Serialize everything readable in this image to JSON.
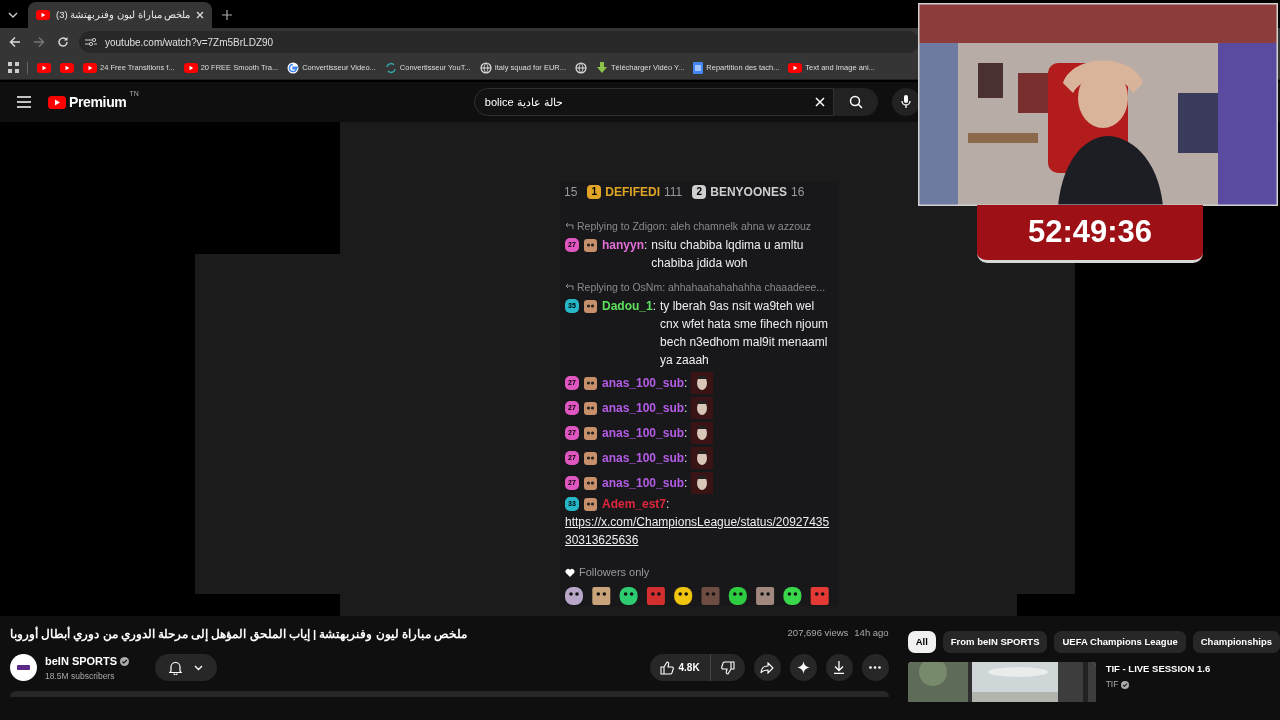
{
  "browser": {
    "tab": {
      "title": "(3) ملخص مباراة ليون وفنربهتشة",
      "selected": true
    },
    "address": "youtube.com/watch?v=7Zm5BrLDZ90",
    "bookmarks": [
      {
        "kind": "youtube"
      },
      {
        "kind": "youtube"
      },
      {
        "kind": "youtube",
        "label": "24 Free Transitions f..."
      },
      {
        "kind": "youtube",
        "label": "20 FREE Smooth Tra..."
      },
      {
        "kind": "google",
        "label": "Convertisseur Video..."
      },
      {
        "kind": "sync",
        "label": "Convertisseur YouT..."
      },
      {
        "kind": "globe",
        "label": "Italy squad for EUR..."
      },
      {
        "kind": "globe"
      },
      {
        "kind": "download",
        "label": "Télécharger Vidéo Y..."
      },
      {
        "kind": "doc",
        "label": "Repartition des tach..."
      },
      {
        "kind": "youtube",
        "label": "Text and Image ani..."
      }
    ]
  },
  "youtube": {
    "logo": "Premium",
    "region": "TN",
    "search": "bolice حالة عادية"
  },
  "stream": {
    "leaderboard": [
      {
        "score": "15"
      },
      {
        "rank": "1",
        "name": "DEFIFEDI",
        "score": "111",
        "color": "#e0a526"
      },
      {
        "rank": "2",
        "name": "BENYOONES",
        "score": "16",
        "color": "#cfcfcf"
      }
    ],
    "messages": [
      {
        "kind": "reply",
        "text": "Replying to Zdigon: aleh chamnelk ahna w azzouz"
      },
      {
        "kind": "message",
        "badge": {
          "text": "27",
          "color": "#e056c1"
        },
        "user": {
          "name": "hanyyn",
          "color": "#e36fd8"
        },
        "separator": ":",
        "text": "nsitu chabiba lqdima u amltu chabiba jdida woh"
      },
      {
        "kind": "reply",
        "text": "Replying to OsNm: ahhahaahahahahha chaaadeee..."
      },
      {
        "kind": "message",
        "badge": {
          "text": "35",
          "color": "#26b8c8"
        },
        "user": {
          "name": "Dadou_1",
          "color": "#5ee05e"
        },
        "separator": ":",
        "text": "ty lberah 9as nsit wa9teh wel cnx wfet hata sme fihech njoum bech n3edhom mal9it menaaml ya zaaah"
      },
      {
        "kind": "message",
        "badge": {
          "text": "27",
          "color": "#e056c1"
        },
        "user": {
          "name": "anas_100_sub",
          "color": "#b55ce6"
        },
        "separator": ":",
        "emote": true
      },
      {
        "kind": "message",
        "badge": {
          "text": "27",
          "color": "#e056c1"
        },
        "user": {
          "name": "anas_100_sub",
          "color": "#b55ce6"
        },
        "separator": ":",
        "emote": true
      },
      {
        "kind": "message",
        "badge": {
          "text": "27",
          "color": "#e056c1"
        },
        "user": {
          "name": "anas_100_sub",
          "color": "#b55ce6"
        },
        "separator": ":",
        "emote": true
      },
      {
        "kind": "message",
        "badge": {
          "text": "27",
          "color": "#e056c1"
        },
        "user": {
          "name": "anas_100_sub",
          "color": "#b55ce6"
        },
        "separator": ":",
        "emote": true
      },
      {
        "kind": "message",
        "badge": {
          "text": "27",
          "color": "#e056c1"
        },
        "user": {
          "name": "anas_100_sub",
          "color": "#b55ce6"
        },
        "separator": ":",
        "emote": true
      },
      {
        "kind": "link",
        "badge": {
          "text": "33",
          "color": "#26b8c8"
        },
        "user": {
          "name": "Adem_est7",
          "color": "#e0263c"
        },
        "separator": ":",
        "text": "https://x.com/ChampionsLeague/status/2092743530313625636"
      }
    ],
    "mode": "Followers only",
    "timer": "52:49:36"
  },
  "video": {
    "title": "ملخص مباراة ليون وفنربهتشة | إياب الملحق المؤهل إلى مرحلة الدوري من دوري أبطال أوروبا",
    "views": "207,696 views",
    "age": "14h ago",
    "channel": {
      "name": "beIN SPORTS",
      "verified": true,
      "subscribers": "18.5M subscribers"
    },
    "likes": "4.8K"
  },
  "chips": [
    {
      "label": "All",
      "selected": true
    },
    {
      "label": "From beIN SPORTS",
      "selected": false
    },
    {
      "label": "UEFA Champions League",
      "selected": false
    },
    {
      "label": "Championships",
      "selected": false
    }
  ],
  "recommended": [
    {
      "title": "TIF - LIVE SESSION 1.6",
      "channel": "TIF",
      "verified": true
    }
  ]
}
